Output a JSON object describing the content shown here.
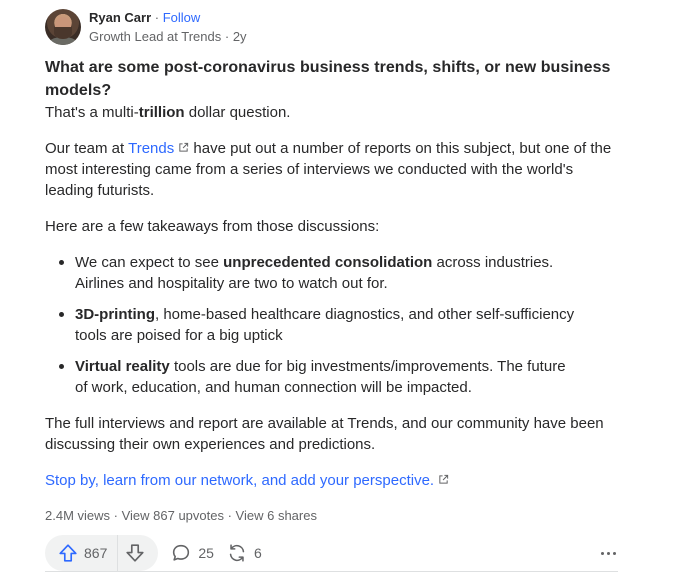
{
  "author": {
    "name": "Ryan Carr",
    "separator": " · ",
    "follow_label": "Follow",
    "credential": "Growth Lead at Trends",
    "time": "2y"
  },
  "question": "What are some post-coronavirus business trends, shifts, or new business models?",
  "answer": {
    "p1_pre": "That's a multi-",
    "p1_bold": "trillion",
    "p1_post": " dollar question.",
    "p2_pre": "Our team at ",
    "p2_link": "Trends",
    "p2_post": " have put out a number of reports on this subject, but one of the most interesting came from a series of interviews we conducted with the world's leading futurists.",
    "p3": "Here are a few takeaways from those discussions:",
    "bullets": [
      {
        "pre": "We can expect to see ",
        "bold": "unprecedented consolidation",
        "post": " across industries. Airlines and hospitality are two to watch out for."
      },
      {
        "pre": "",
        "bold": "3D-printing",
        "post": ", home-based healthcare diagnostics, and other self-sufficiency tools are poised for a big uptick"
      },
      {
        "pre": "",
        "bold": "Virtual reality",
        "post": " tools are due for big investments/improvements. The future of work, education, and human connection will be impacted."
      }
    ],
    "p4": "The full interviews and report are available at Trends, and our community have been discussing their own experiences and predictions.",
    "cta_link": "Stop by, learn from our network, and add your perspective."
  },
  "stats": {
    "views": "2.4M views",
    "sep": " · ",
    "upvotes": "View 867 upvotes",
    "shares": "View 6 shares"
  },
  "actions": {
    "upvote_count": "867",
    "comment_count": "25",
    "share_count": "6"
  },
  "colors": {
    "link": "#2e69ff",
    "text": "#282829",
    "muted": "#636466",
    "pill": "#f1f2f2"
  }
}
